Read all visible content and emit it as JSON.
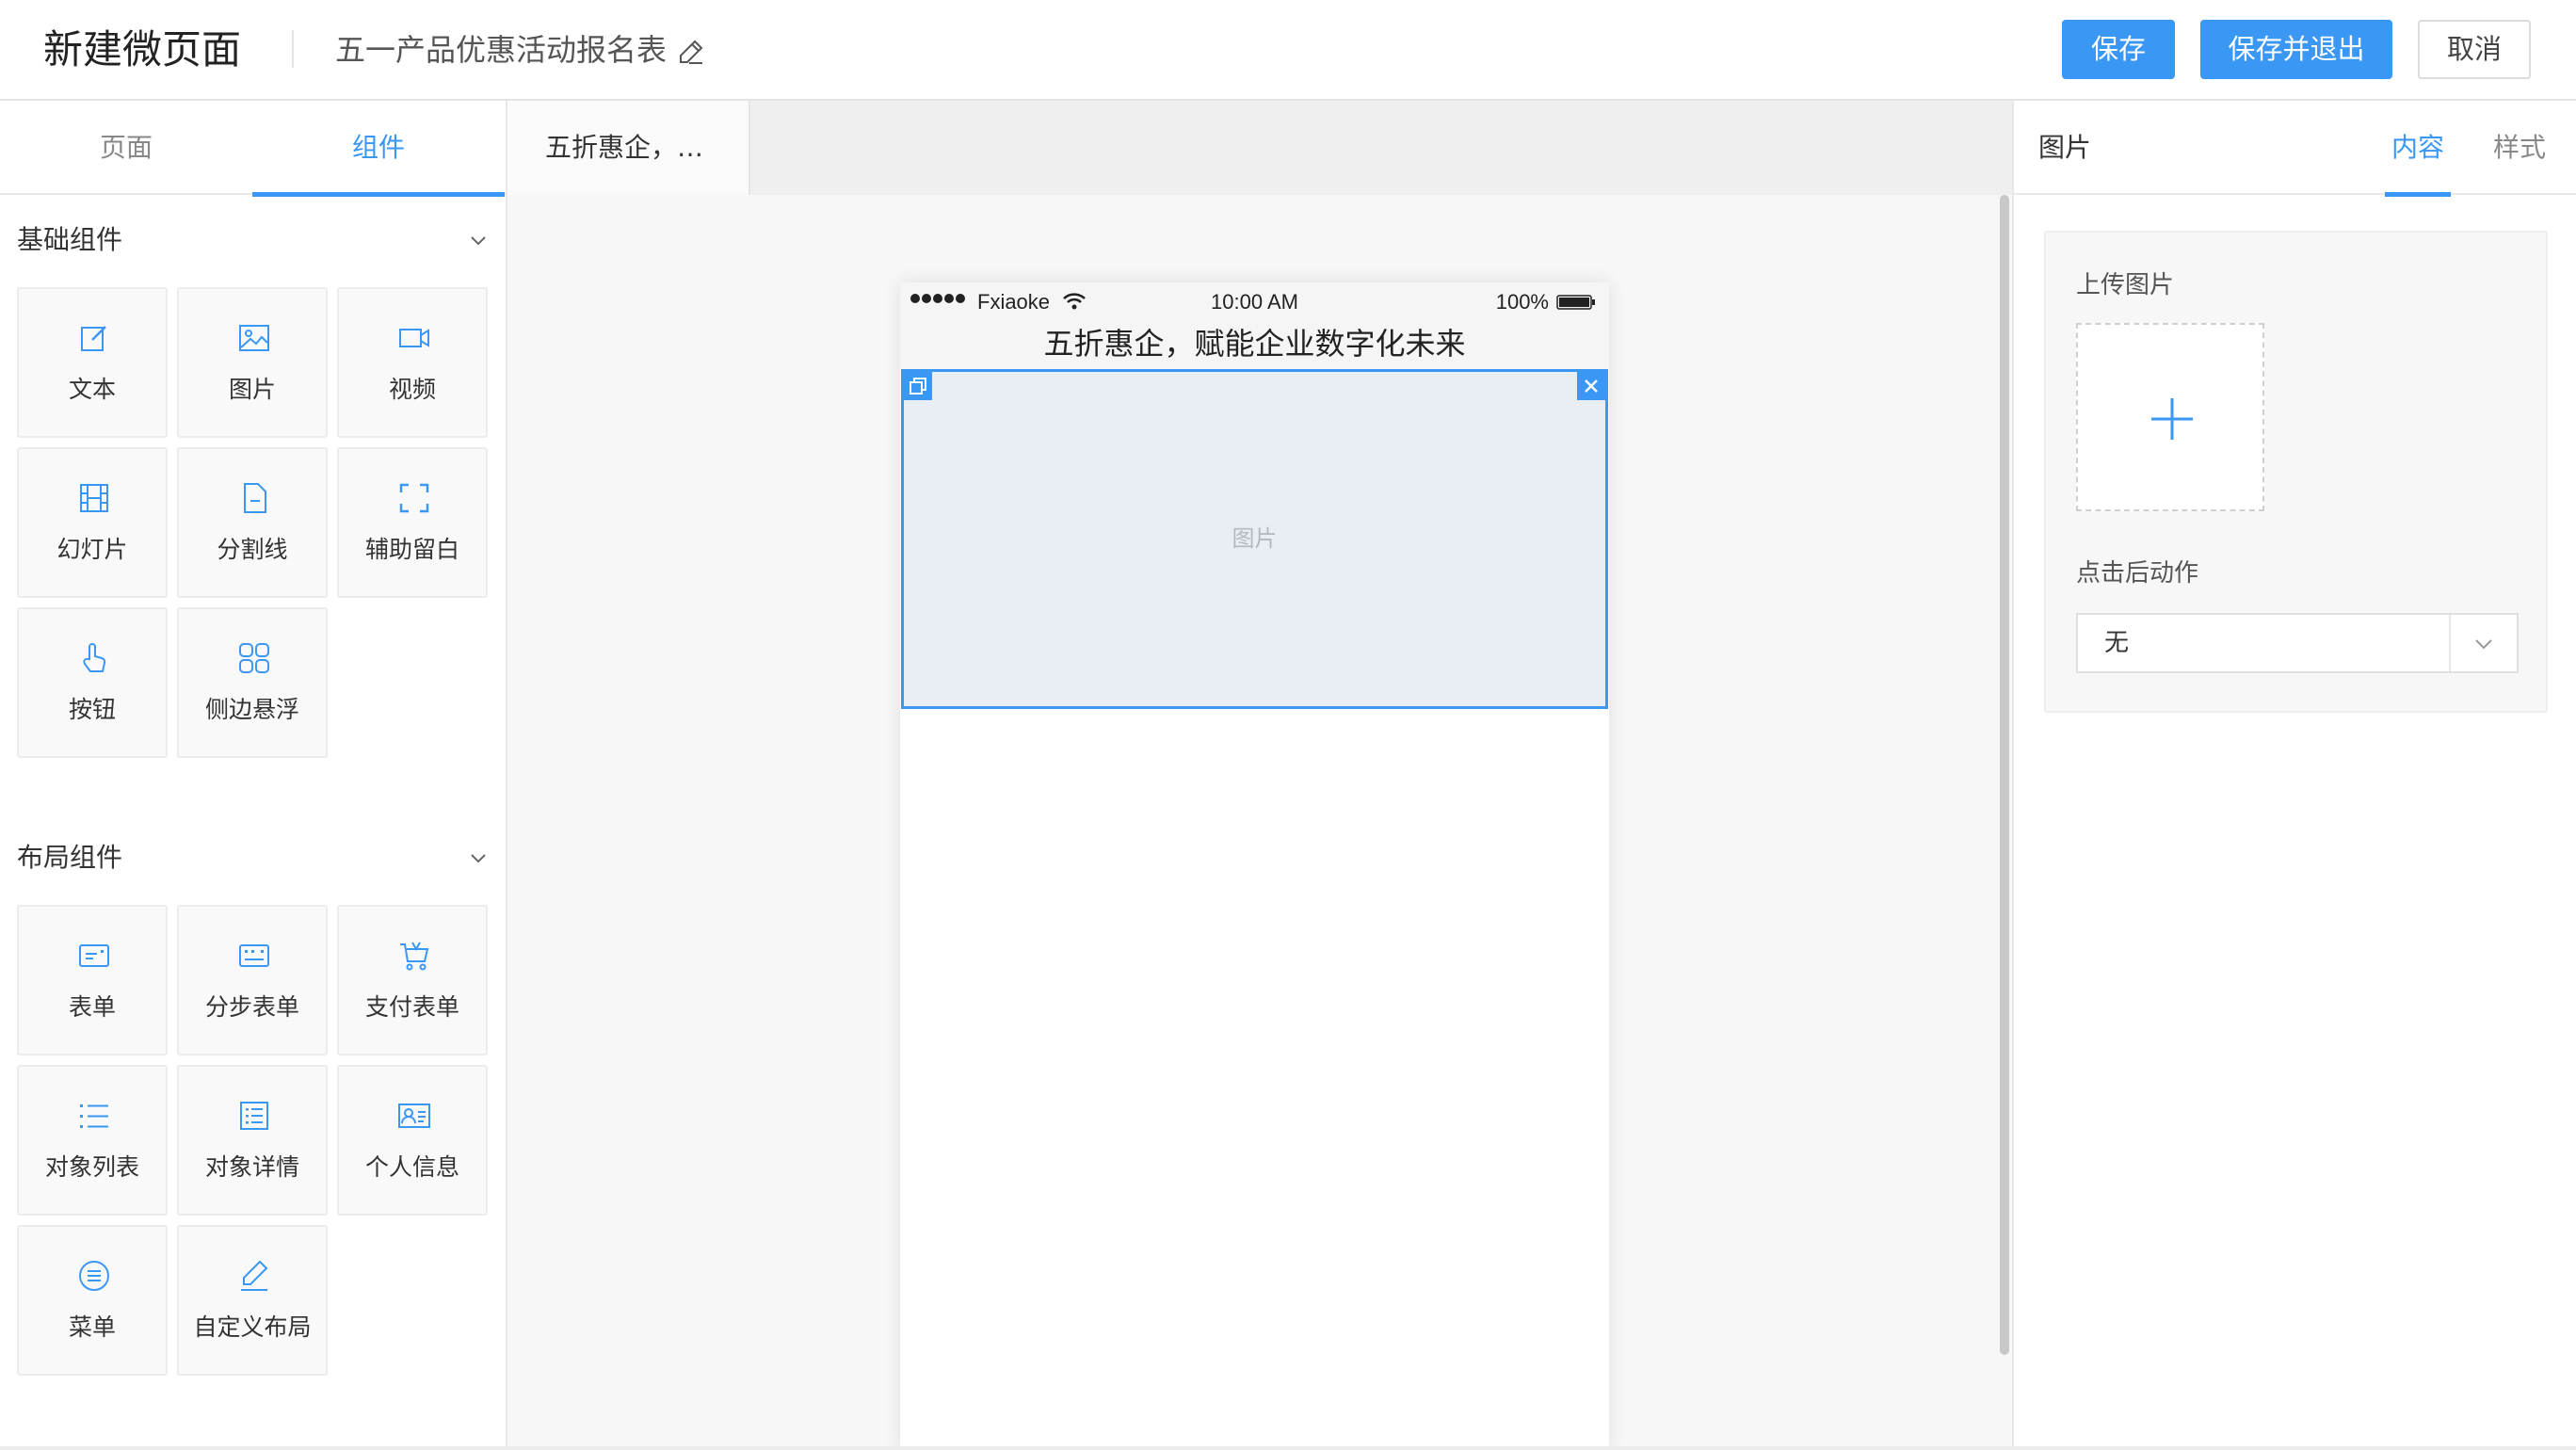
{
  "header": {
    "title": "新建微页面",
    "form_name": "五一产品优惠活动报名表",
    "save_label": "保存",
    "save_exit_label": "保存并退出",
    "cancel_label": "取消"
  },
  "left_panel": {
    "tabs": [
      "页面",
      "组件"
    ],
    "active_tab": "组件",
    "sections": [
      {
        "title": "基础组件",
        "items": [
          {
            "label": "文本",
            "icon": "edit-icon"
          },
          {
            "label": "图片",
            "icon": "image-icon"
          },
          {
            "label": "视频",
            "icon": "video-icon"
          },
          {
            "label": "幻灯片",
            "icon": "slides-icon"
          },
          {
            "label": "分割线",
            "icon": "divider-icon"
          },
          {
            "label": "辅助留白",
            "icon": "whitespace-icon"
          },
          {
            "label": "按钮",
            "icon": "pointer-icon"
          },
          {
            "label": "侧边悬浮",
            "icon": "grid-icon"
          }
        ]
      },
      {
        "title": "布局组件",
        "items": [
          {
            "label": "表单",
            "icon": "form-icon"
          },
          {
            "label": "分步表单",
            "icon": "step-form-icon"
          },
          {
            "label": "支付表单",
            "icon": "cart-icon"
          },
          {
            "label": "对象列表",
            "icon": "list-icon"
          },
          {
            "label": "对象详情",
            "icon": "detail-icon"
          },
          {
            "label": "个人信息",
            "icon": "id-card-icon"
          },
          {
            "label": "菜单",
            "icon": "menu-icon"
          },
          {
            "label": "自定义布局",
            "icon": "pen-icon"
          }
        ]
      }
    ]
  },
  "center": {
    "tab_label": "五折惠企，…",
    "phone": {
      "carrier": "Fxiaoke",
      "time": "10:00 AM",
      "battery": "100%",
      "page_title": "五折惠企，赋能企业数字化未来",
      "image_placeholder": "图片"
    }
  },
  "right_panel": {
    "title": "图片",
    "tabs": [
      "内容",
      "样式"
    ],
    "active_tab": "内容",
    "upload_label": "上传图片",
    "action_label": "点击后动作",
    "action_value": "无"
  },
  "colors": {
    "accent": "#3a97f4",
    "image_bg": "#e9edf4"
  }
}
